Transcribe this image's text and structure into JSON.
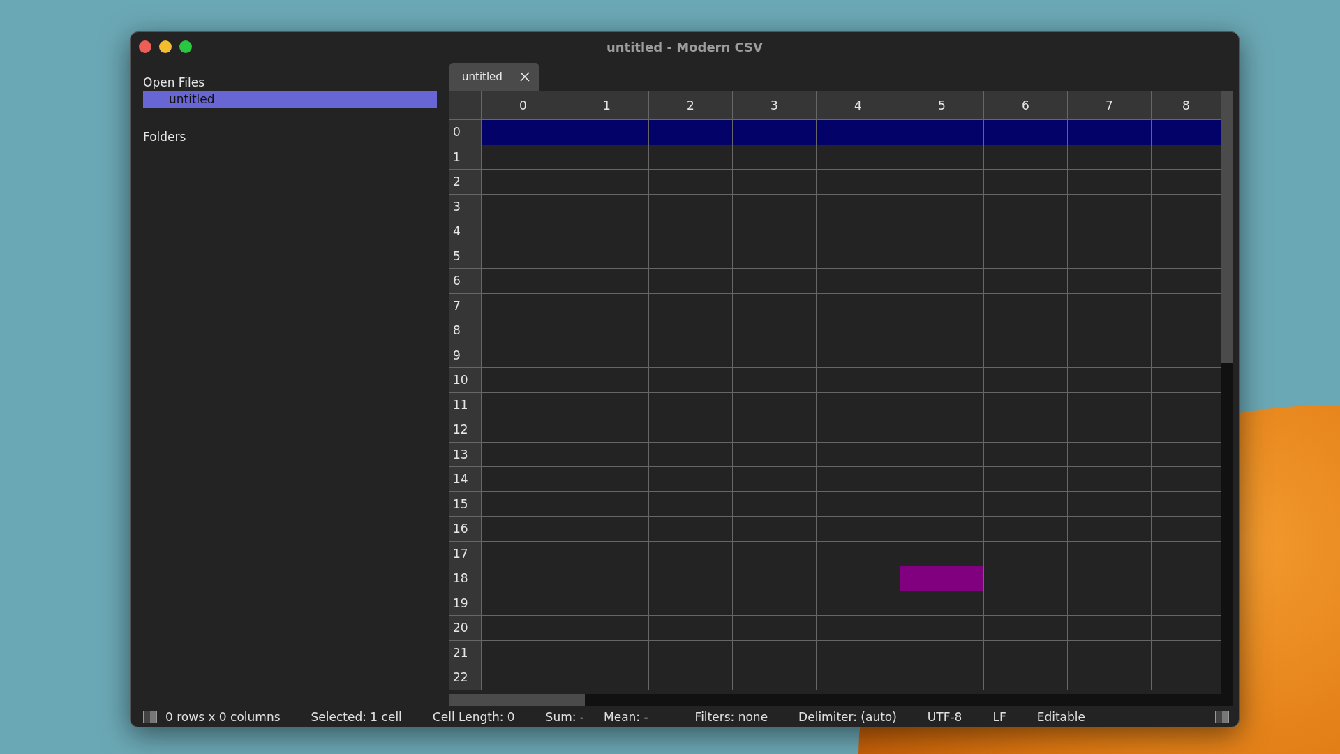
{
  "window": {
    "title": "untitled - Modern CSV"
  },
  "sidebar": {
    "sections": [
      {
        "heading": "Open Files",
        "items": [
          {
            "label": "untitled",
            "selected": true
          }
        ]
      },
      {
        "heading": "Folders"
      }
    ]
  },
  "tabs": [
    {
      "label": "untitled",
      "selected": true
    }
  ],
  "grid": {
    "columns": [
      {
        "label": "0",
        "current": false
      },
      {
        "label": "1",
        "current": false
      },
      {
        "label": "2",
        "current": false
      },
      {
        "label": "3",
        "current": false
      },
      {
        "label": "4",
        "current": false
      },
      {
        "label": "5",
        "current": true
      },
      {
        "label": "6",
        "current": false
      },
      {
        "label": "7",
        "current": false
      },
      {
        "label": "8",
        "current": false
      }
    ],
    "rows": [
      {
        "label": "0",
        "selected": true,
        "current": false
      },
      {
        "label": "1",
        "selected": false,
        "current": false
      },
      {
        "label": "2",
        "selected": false,
        "current": false
      },
      {
        "label": "3",
        "selected": false,
        "current": false
      },
      {
        "label": "4",
        "selected": false,
        "current": false
      },
      {
        "label": "5",
        "selected": false,
        "current": false
      },
      {
        "label": "6",
        "selected": false,
        "current": false
      },
      {
        "label": "7",
        "selected": false,
        "current": false
      },
      {
        "label": "8",
        "selected": false,
        "current": false
      },
      {
        "label": "9",
        "selected": false,
        "current": false
      },
      {
        "label": "10",
        "selected": false,
        "current": false
      },
      {
        "label": "11",
        "selected": false,
        "current": false
      },
      {
        "label": "12",
        "selected": false,
        "current": false
      },
      {
        "label": "13",
        "selected": false,
        "current": false
      },
      {
        "label": "14",
        "selected": false,
        "current": false
      },
      {
        "label": "15",
        "selected": false,
        "current": false
      },
      {
        "label": "16",
        "selected": false,
        "current": false
      },
      {
        "label": "17",
        "selected": false,
        "current": false
      },
      {
        "label": "18",
        "selected": false,
        "current": true
      },
      {
        "label": "19",
        "selected": false,
        "current": false
      },
      {
        "label": "20",
        "selected": false,
        "current": false
      },
      {
        "label": "21",
        "selected": false,
        "current": false
      },
      {
        "label": "22",
        "selected": false,
        "current": false
      }
    ]
  },
  "status_bar": {
    "items": [
      "0 rows x 0 columns",
      "Selected: 1 cell",
      "Cell Length: 0",
      "Sum: -",
      "Mean: -",
      "Filters: none",
      "Delimiter: (auto)",
      "UTF-8",
      "LF",
      "Editable"
    ]
  }
}
